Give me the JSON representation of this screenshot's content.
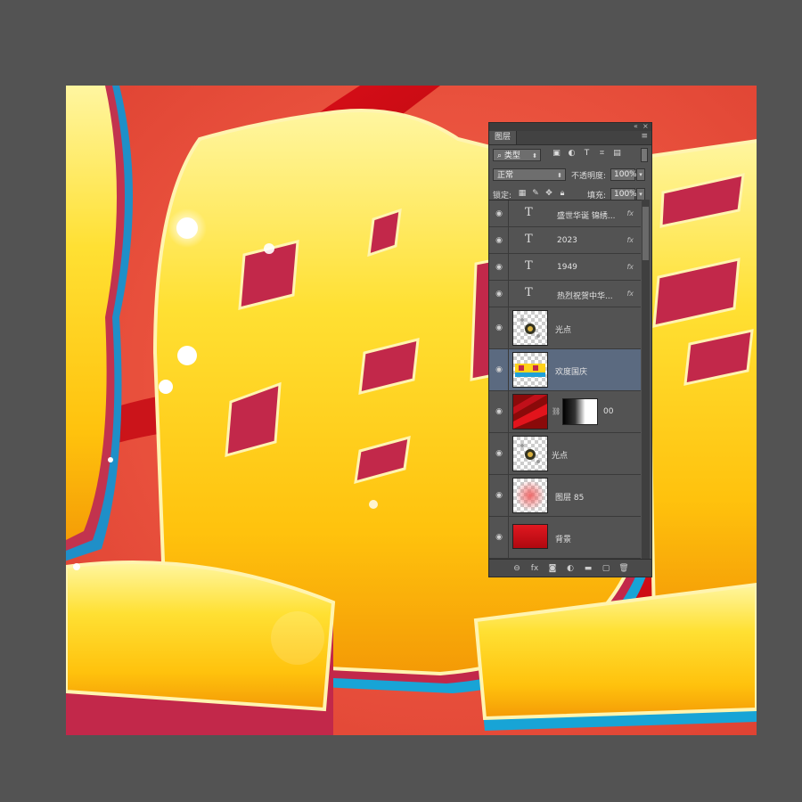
{
  "panel": {
    "tab_label": "图层",
    "filter_kind": "类型",
    "blend_mode": "正常",
    "opacity_label": "不透明度:",
    "opacity_value": "100%",
    "lock_label": "锁定:",
    "fill_label": "填充:",
    "fill_value": "100%"
  },
  "layers": [
    {
      "name": "盛世华诞  锦绣...",
      "kind": "text",
      "fx": "fx",
      "visible": true,
      "selected": false
    },
    {
      "name": "2023",
      "kind": "text",
      "fx": "fx",
      "visible": true,
      "selected": false
    },
    {
      "name": "1949",
      "kind": "text",
      "fx": "fx",
      "visible": true,
      "selected": false
    },
    {
      "name": "热烈祝贺中华...",
      "kind": "text",
      "fx": "fx",
      "visible": true,
      "selected": false
    },
    {
      "name": "光点",
      "kind": "raster",
      "thumb": "sparkles",
      "visible": true,
      "selected": false
    },
    {
      "name": "欢度国庆",
      "kind": "raster",
      "thumb": "title-art",
      "visible": true,
      "selected": true
    },
    {
      "name": "00",
      "kind": "masked",
      "thumb": "red-ribbon",
      "visible": true,
      "selected": false
    },
    {
      "name": "光点",
      "kind": "raster",
      "thumb": "sparkles",
      "visible": true,
      "selected": false
    },
    {
      "name": "图层 85",
      "kind": "raster",
      "thumb": "pink-glow",
      "visible": true,
      "selected": false
    },
    {
      "name": "背景",
      "kind": "raster",
      "thumb": "red-bg",
      "visible": true,
      "selected": false
    }
  ],
  "colors": {
    "workspace": "#535353",
    "canvas_red": "#e9513d",
    "gold": "#ffd21a",
    "ribbon": "#d4111a",
    "selected_layer": "#5b6a80"
  },
  "icons": {
    "eye": "eye-icon",
    "text_layer": "text-layer-icon",
    "link": "link-icon",
    "fx": "fx-icon",
    "trash": "trash-icon"
  }
}
